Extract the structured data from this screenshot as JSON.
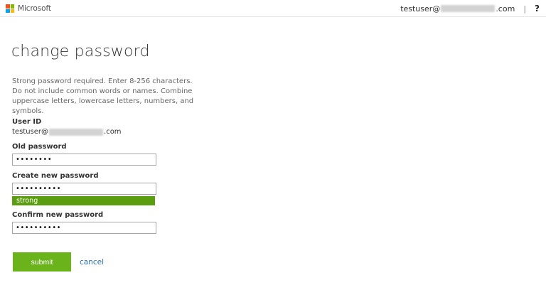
{
  "header": {
    "brand": "Microsoft",
    "user_prefix": "testuser@",
    "user_suffix": ".com",
    "separator": "|",
    "help": "?",
    "logo_colors": [
      "#f25022",
      "#7fba00",
      "#00a4ef",
      "#ffb900"
    ]
  },
  "page": {
    "title": "change password",
    "description": "Strong password required. Enter 8-256 characters. Do not include common words or names. Combine uppercase letters, lowercase letters, numbers, and symbols."
  },
  "form": {
    "user_id_label": "User ID",
    "user_id_prefix": "testuser@",
    "user_id_suffix": ".com",
    "old_password_label": "Old password",
    "old_password_value": "••••••••",
    "new_password_label": "Create new password",
    "new_password_value": "••••••••••",
    "strength_label": "strong",
    "confirm_password_label": "Confirm new password",
    "confirm_password_value": "••••••••••",
    "submit_label": "submit",
    "cancel_label": "cancel"
  },
  "colors": {
    "accent_green": "#6ab31b",
    "strength_green": "#5a9e0f",
    "link_blue": "#2b6fb6"
  }
}
